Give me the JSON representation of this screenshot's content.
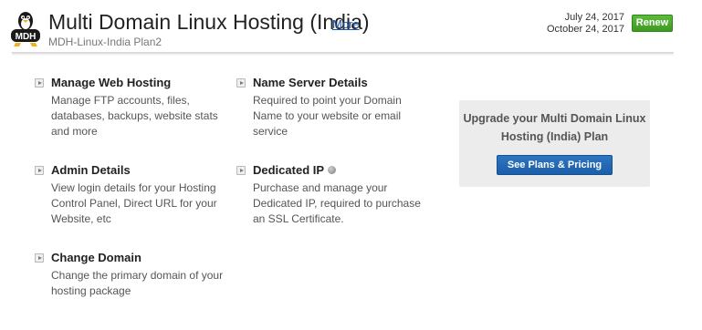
{
  "header": {
    "logo_text": "MDH",
    "title": "Multi Domain Linux Hosting (India)",
    "more_link": "More",
    "plan_name": "MDH-Linux-India Plan2",
    "dates": [
      "July 24, 2017",
      "October 24, 2017"
    ],
    "renew_label": "Renew"
  },
  "features": [
    {
      "title": "Manage Web Hosting",
      "description": "Manage FTP accounts, files, databases, backups, website stats and more",
      "icon": "arrow-right-icon"
    },
    {
      "title": "Name Server Details",
      "description": "Required to point your Domain Name to your website or email service",
      "icon": "arrow-right-icon"
    },
    {
      "title": "Admin Details",
      "description": "View login details for your Hosting Control Panel, Direct URL for your Website, etc",
      "icon": "arrow-right-icon"
    },
    {
      "title": "Dedicated IP",
      "description": "Purchase and manage your Dedicated IP, required to purchase an SSL Certificate.",
      "icon": "arrow-right-icon",
      "status_icon": "status-dot-icon"
    },
    {
      "title": "Change Domain",
      "description": "Change the primary domain of your hosting package",
      "icon": "arrow-right-icon"
    }
  ],
  "upgrade": {
    "text": "Upgrade your Multi Domain Linux Hosting (India) Plan",
    "button_label": "See Plans & Pricing"
  },
  "colors": {
    "renew_green": "#4caf2f",
    "plans_blue": "#1f63b0",
    "link_blue": "#1a53a8",
    "panel_gray": "#ececec"
  }
}
